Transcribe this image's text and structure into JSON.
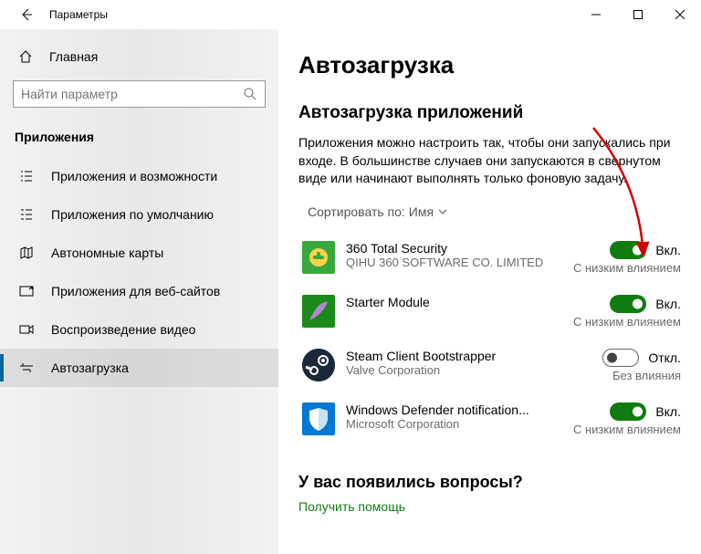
{
  "titlebar": {
    "title": "Параметры"
  },
  "sidebar": {
    "home": "Главная",
    "search_placeholder": "Найти параметр",
    "section": "Приложения",
    "items": [
      "Приложения и возможности",
      "Приложения по умолчанию",
      "Автономные карты",
      "Приложения для веб-сайтов",
      "Воспроизведение видео",
      "Автозагрузка"
    ]
  },
  "main": {
    "title": "Автозагрузка",
    "subtitle": "Автозагрузка приложений",
    "desc": "Приложения можно настроить так, чтобы они запускались при входе. В большинстве случаев они запускаются в свернутом виде или начинают выполнять только фоновую задачу.",
    "sort_label": "Сортировать по:",
    "sort_value": "Имя",
    "on_label": "Вкл.",
    "off_label": "Откл.",
    "apps": [
      {
        "name": "360 Total Security",
        "pub": "QIHU 360 SOFTWARE CO. LIMITED",
        "on": true,
        "impact": "С низким влиянием"
      },
      {
        "name": "Starter Module",
        "pub": "",
        "on": true,
        "impact": "С низким влиянием"
      },
      {
        "name": "Steam Client Bootstrapper",
        "pub": "Valve Corporation",
        "on": false,
        "impact": "Без влияния"
      },
      {
        "name": "Windows Defender notification...",
        "pub": "Microsoft Corporation",
        "on": true,
        "impact": "С низким влиянием"
      }
    ],
    "help_title": "У вас появились вопросы?",
    "help_link": "Получить помощь"
  }
}
